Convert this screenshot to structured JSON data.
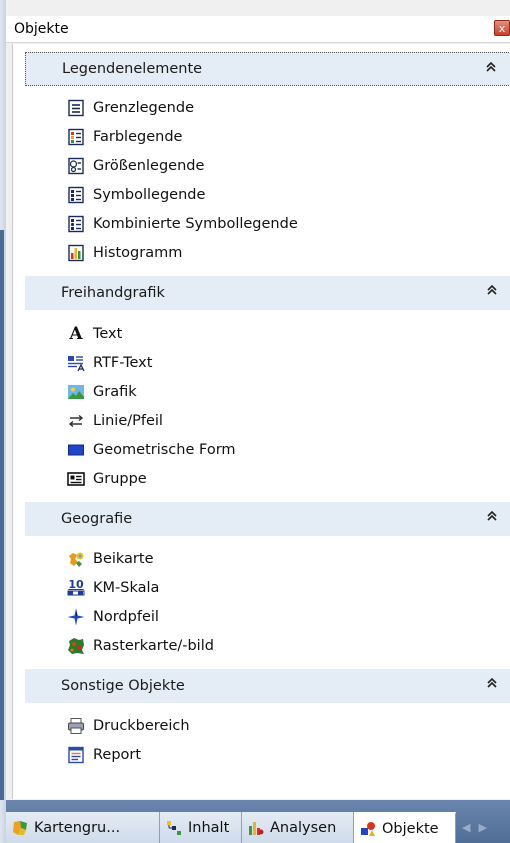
{
  "window": {
    "title": "Objekte",
    "close_label": "x"
  },
  "sections": [
    {
      "label": "Legendenelemente",
      "collapse_icon": "double-chevron-up-icon",
      "items": [
        {
          "label": "Grenzlegende",
          "icon": "border-legend-icon"
        },
        {
          "label": "Farblegende",
          "icon": "color-legend-icon"
        },
        {
          "label": "Größenlegende",
          "icon": "size-legend-icon"
        },
        {
          "label": "Symbollegende",
          "icon": "symbol-legend-icon"
        },
        {
          "label": "Kombinierte Symbollegende",
          "icon": "combined-symbol-legend-icon"
        },
        {
          "label": "Histogramm",
          "icon": "histogram-icon"
        }
      ]
    },
    {
      "label": "Freihandgrafik",
      "collapse_icon": "double-chevron-up-icon",
      "items": [
        {
          "label": "Text",
          "icon": "text-icon"
        },
        {
          "label": "RTF-Text",
          "icon": "rtf-text-icon"
        },
        {
          "label": "Grafik",
          "icon": "image-icon"
        },
        {
          "label": "Linie/Pfeil",
          "icon": "line-arrow-icon"
        },
        {
          "label": "Geometrische Form",
          "icon": "rectangle-shape-icon"
        },
        {
          "label": "Gruppe",
          "icon": "group-icon"
        }
      ]
    },
    {
      "label": "Geografie",
      "collapse_icon": "double-chevron-up-icon",
      "items": [
        {
          "label": "Beikarte",
          "icon": "inset-map-icon"
        },
        {
          "label": "KM-Skala",
          "icon": "scale-bar-icon"
        },
        {
          "label": "Nordpfeil",
          "icon": "north-arrow-icon"
        },
        {
          "label": "Rasterkarte/-bild",
          "icon": "raster-map-icon"
        }
      ]
    },
    {
      "label": "Sonstige Objekte",
      "collapse_icon": "double-chevron-up-icon",
      "items": [
        {
          "label": "Druckbereich",
          "icon": "printer-icon"
        },
        {
          "label": "Report",
          "icon": "report-icon"
        }
      ]
    }
  ],
  "scale_icon_text": "10",
  "text_icon_glyph": "A",
  "tabs": [
    {
      "label": "Kartengru...",
      "icon": "map-groups-icon",
      "active": false
    },
    {
      "label": "Inhalt",
      "icon": "content-icon",
      "active": false
    },
    {
      "label": "Analysen",
      "icon": "analyses-icon",
      "active": false
    },
    {
      "label": "Objekte",
      "icon": "objects-icon",
      "active": true
    }
  ],
  "colors": {
    "section_bg": "#e4ecf5",
    "tab_bar": "#5b79a3",
    "accent": "#1e46c8"
  }
}
